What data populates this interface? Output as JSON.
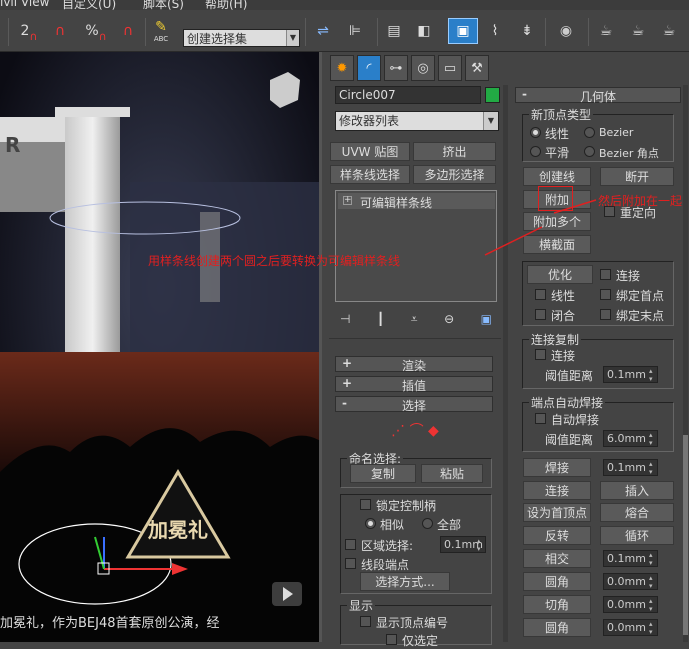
{
  "menubar": {
    "items": [
      "ivil View",
      "自定义(U)",
      "脚本(S)",
      "帮助(H)"
    ]
  },
  "toolbar": {
    "num_2": "2",
    "percent": "%",
    "abc": "ABC",
    "selection_set": "创建选择集"
  },
  "viewport": {
    "subtitle": "加冕礼，作为BEJ48首套原创公演，经",
    "watermark": "加冕礼"
  },
  "annotations": {
    "main": "用样条线创建两个圆之后要转换为可编辑样条线",
    "attach": "然后附加在一起"
  },
  "panel": {
    "object_name": "Circle007",
    "object_color": "#22aa44",
    "modifier_list": "修改器列表",
    "btn_uvw": "UVW 贴图",
    "btn_extrude": "挤出",
    "btn_spline_sel": "样条线选择",
    "btn_poly_sel": "多边形选择",
    "stack_item": "可编辑样条线",
    "rollout_render": "渲染",
    "rollout_interp": "插值",
    "rollout_select": "选择",
    "named_sel": "命名选择:",
    "btn_copy": "复制",
    "btn_paste": "粘贴",
    "lock_handles": "锁定控制柄",
    "similar": "相似",
    "all": "全部",
    "area_sel": "区域选择:",
    "area_val": "0.1mm",
    "seg_end": "线段端点",
    "btn_select_by": "选择方式...",
    "display": "显示",
    "show_vertex_num": "显示顶点编号",
    "only_selected": "仅选定"
  },
  "geometry": {
    "title": "几何体",
    "new_vertex_type": "新顶点类型",
    "linear": "线性",
    "bezier": "Bezier",
    "smooth": "平滑",
    "bezier_corner": "Bezier 角点",
    "btn_create_line": "创建线",
    "btn_break": "断开",
    "btn_attach": "附加",
    "reorient": "重定向",
    "btn_attach_mult": "附加多个",
    "btn_cross_section": "横截面",
    "btn_refine": "优化",
    "connect": "连接",
    "linear2": "线性",
    "bind_first": "绑定首点",
    "closed": "闭合",
    "bind_last": "绑定末点",
    "connect_copy": "连接复制",
    "connect2": "连接",
    "threshold": "阈值距离",
    "threshold_val": "0.1mm",
    "end_auto_weld": "端点自动焊接",
    "auto_weld": "自动焊接",
    "threshold2": "阈值距离",
    "threshold2_val": "6.0mm",
    "btn_weld": "焊接",
    "weld_val": "0.1mm",
    "btn_connect": "连接",
    "btn_insert": "插入",
    "btn_make_first": "设为首顶点",
    "btn_fuse": "熔合",
    "btn_reverse": "反转",
    "btn_cycle": "循环",
    "btn_cross": "相交",
    "cross_val": "0.1mm",
    "btn_fillet": "圆角",
    "fillet_val": "0.0mm",
    "btn_chamfer": "切角",
    "chamfer_val": "0.0mm",
    "btn_outline": "圆角",
    "outline_val": "0.0mm"
  },
  "colors": {
    "annotation": "#e02020",
    "highlight": "#2a7fc9"
  }
}
